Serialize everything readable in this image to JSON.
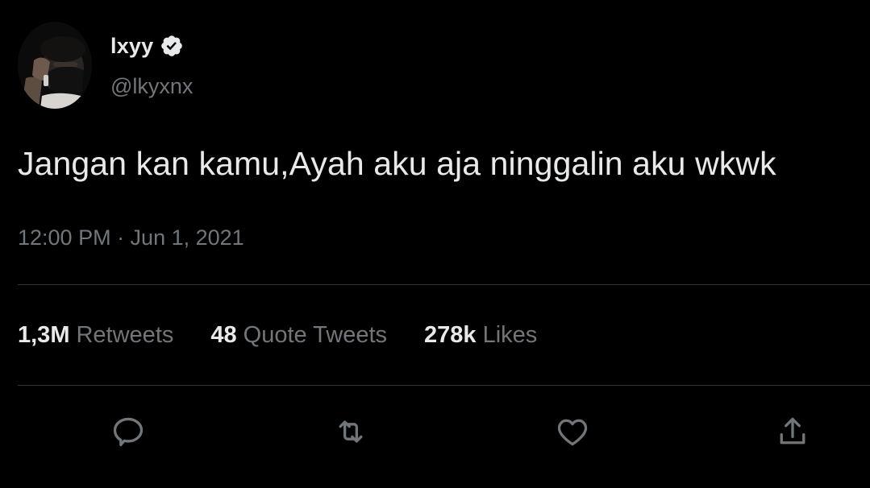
{
  "author": {
    "display_name": "lxyy",
    "handle": "@lkyxnx",
    "verified": true,
    "avatar_icon": "profile-photo"
  },
  "tweet": {
    "text": "Jangan kan kamu,Ayah aku aja ninggalin aku wkwk",
    "meta": "12:00 PM · Jun 1, 2021"
  },
  "stats": {
    "retweets": {
      "count": "1,3M",
      "label": "Retweets"
    },
    "quotes": {
      "count": "48",
      "label": "Quote Tweets"
    },
    "likes": {
      "count": "278k",
      "label": "Likes"
    }
  },
  "actions": {
    "reply_icon": "reply-icon",
    "retweet_icon": "retweet-icon",
    "like_icon": "heart-icon",
    "share_icon": "share-icon"
  },
  "colors": {
    "background": "#000000",
    "text_primary": "#e7e9ea",
    "text_secondary": "#71767b",
    "divider": "#2f3336"
  }
}
